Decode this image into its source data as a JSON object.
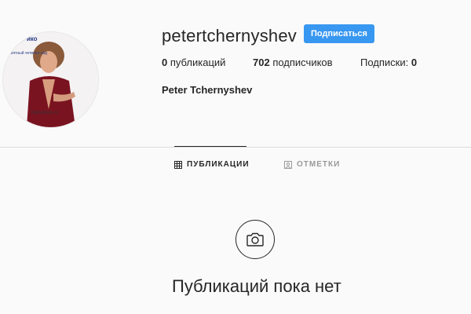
{
  "profile": {
    "username": "petertchernyshev",
    "follow_label": "Подписаться",
    "full_name": "Peter Tchernyshev",
    "avatar": {
      "wordmark_top": "естр\nико",
      "wordmark_sub": "ениятный четвнее сад",
      "wordmark_bottom": "liebsonice.co"
    }
  },
  "stats": {
    "posts_count": "0",
    "posts_label": " публикаций",
    "followers_count": "702",
    "followers_label": " подписчиков",
    "following_label": "Подписки: ",
    "following_count": "0"
  },
  "tabs": {
    "posts_label": "ПУБЛИКАЦИИ",
    "tagged_label": "ОТМЕТКИ"
  },
  "empty_state": {
    "text": "Публикаций пока нет",
    "icon": "camera-icon"
  },
  "colors": {
    "accent": "#3897f0",
    "background": "#fafafa",
    "text": "#262626",
    "muted": "#999999",
    "border": "#dbdbdb"
  }
}
